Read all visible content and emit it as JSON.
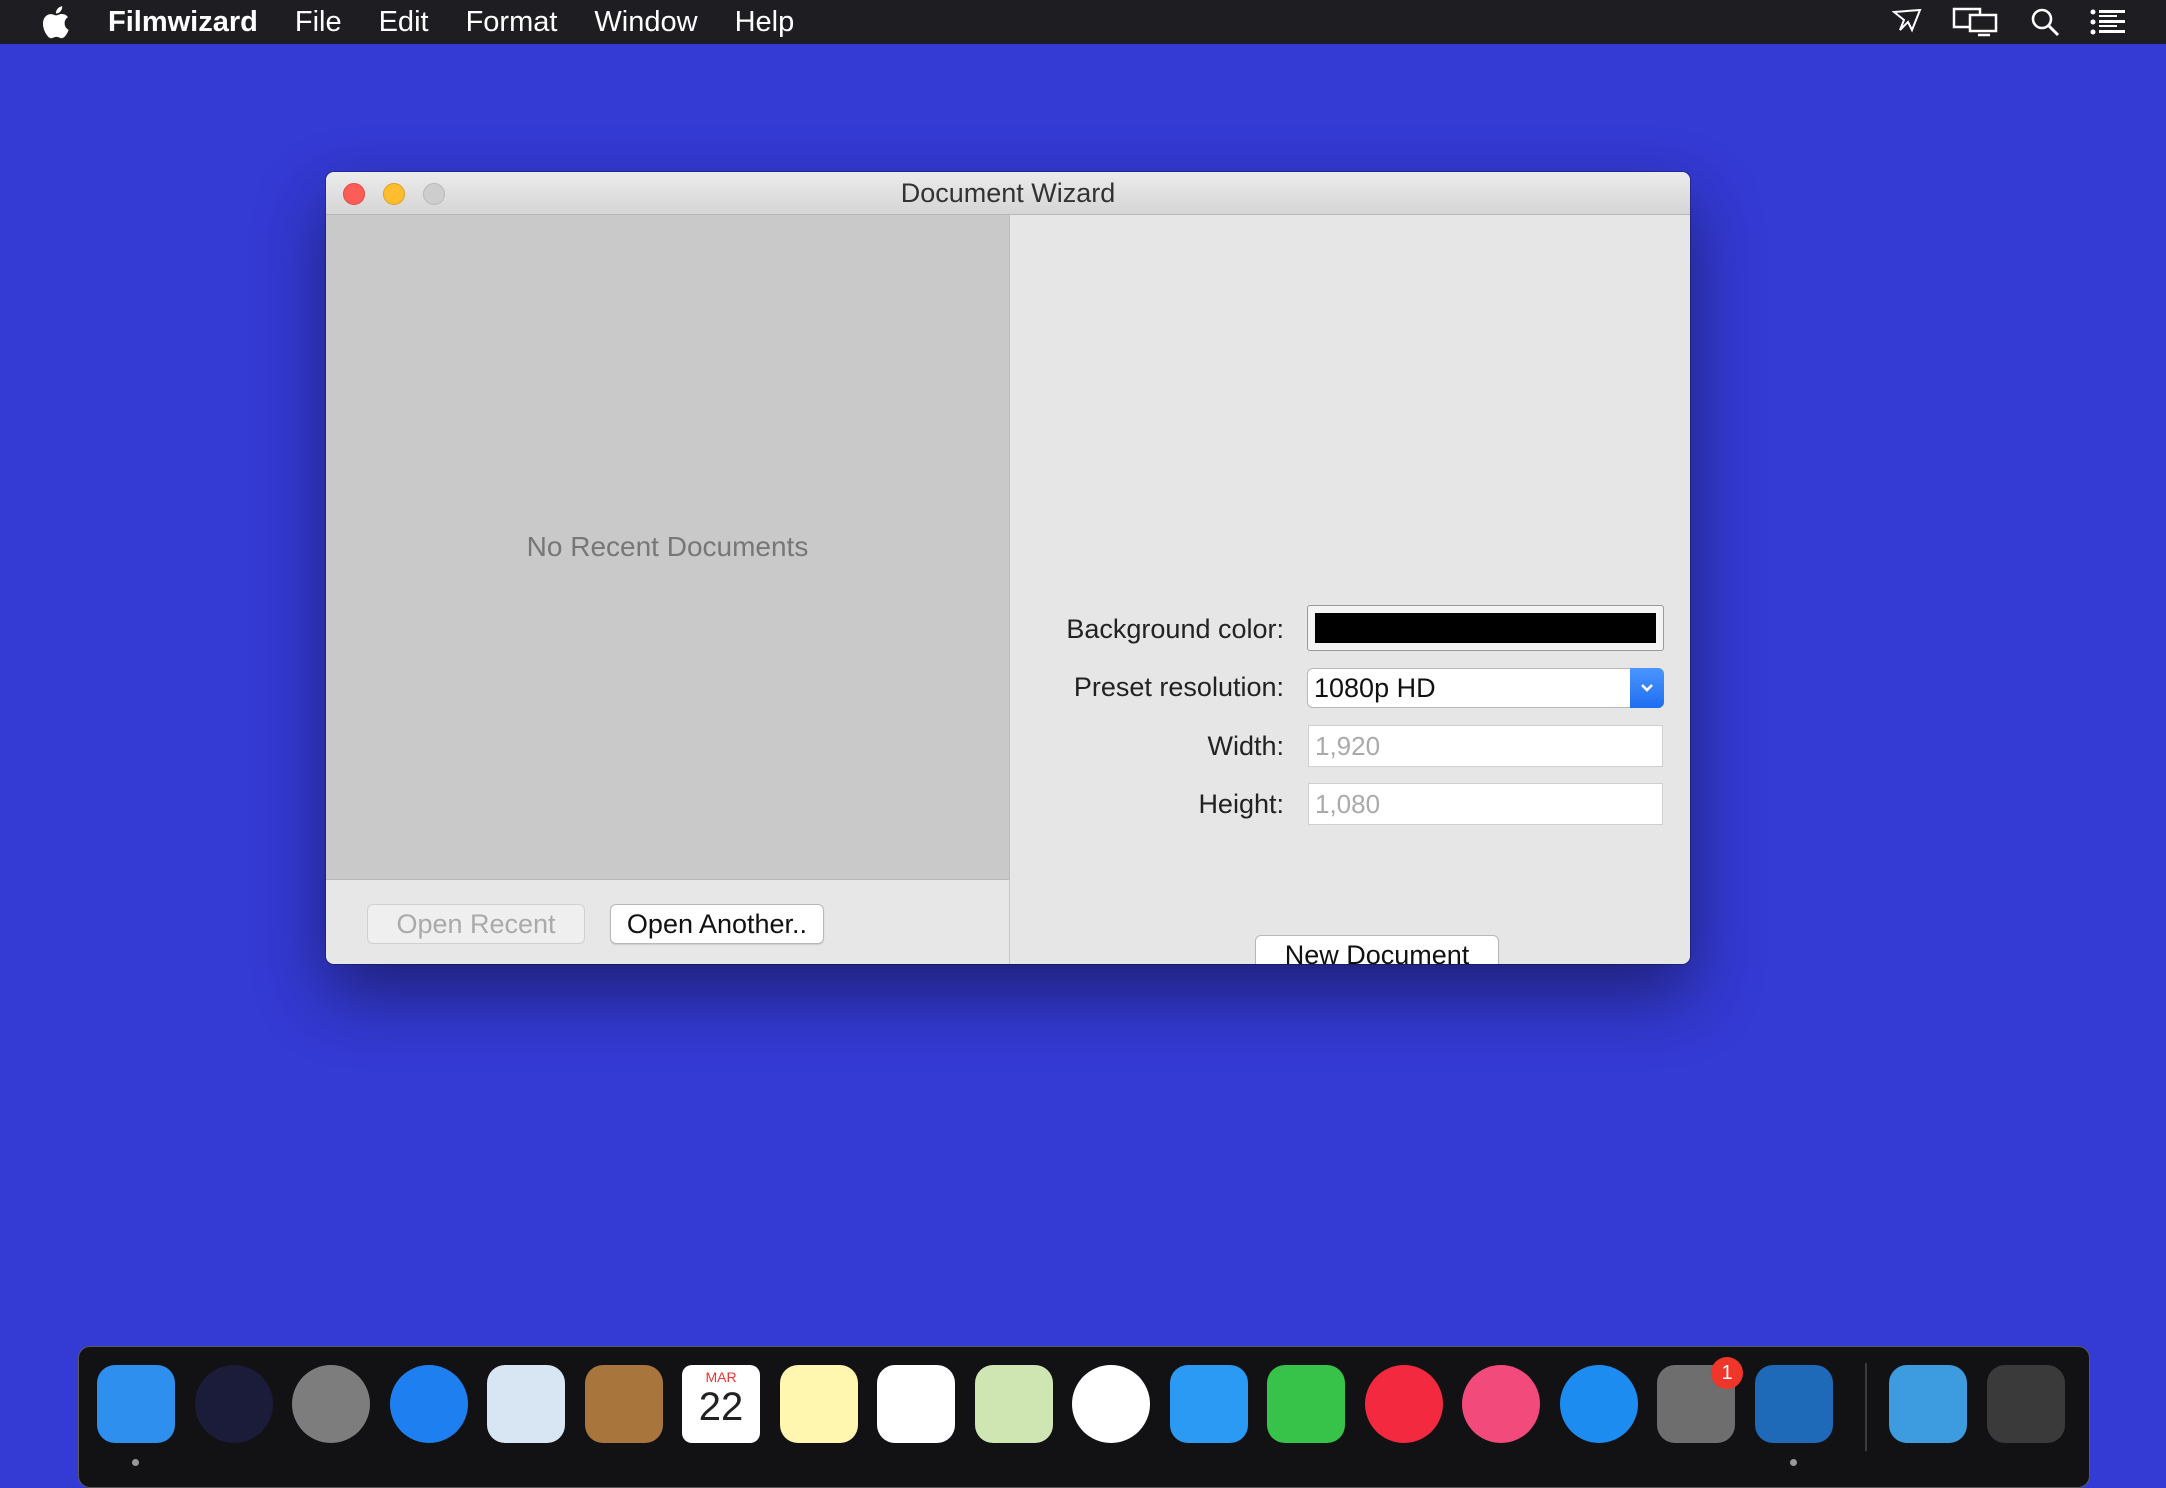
{
  "menubar": {
    "app_name": "Filmwizard",
    "items": [
      "File",
      "Edit",
      "Format",
      "Window",
      "Help"
    ],
    "status_icons": [
      "airplay-icon",
      "display-mirroring-icon",
      "spotlight-search-icon",
      "notification-center-icon"
    ]
  },
  "window": {
    "title": "Document Wizard",
    "left_pane": {
      "empty_message": "No Recent Documents",
      "open_recent_label": "Open Recent",
      "open_another_label": "Open Another.."
    },
    "form": {
      "background_color_label": "Background color:",
      "background_color_value": "#000000",
      "preset_label": "Preset resolution:",
      "preset_value": "1080p HD",
      "width_label": "Width:",
      "width_value": "1,920",
      "height_label": "Height:",
      "height_value": "1,080",
      "new_document_label": "New Document"
    }
  },
  "dock": {
    "items": [
      {
        "name": "finder-icon",
        "color": "#2f8fef",
        "running": true
      },
      {
        "name": "siri-icon",
        "color": "#1b1b3a"
      },
      {
        "name": "launchpad-icon",
        "color": "#7d7d7d"
      },
      {
        "name": "safari-icon",
        "color": "#1e7ff0"
      },
      {
        "name": "mail-icon",
        "color": "#d8e6f4"
      },
      {
        "name": "contacts-icon",
        "color": "#a8753d"
      },
      {
        "name": "calendar-icon",
        "color": "#ffffff",
        "month": "MAR",
        "day": "22"
      },
      {
        "name": "notes-icon",
        "color": "#fff6b0"
      },
      {
        "name": "reminders-icon",
        "color": "#ffffff"
      },
      {
        "name": "maps-icon",
        "color": "#cfe6b3"
      },
      {
        "name": "photos-icon",
        "color": "#ffffff"
      },
      {
        "name": "messages-icon",
        "color": "#2a9af5"
      },
      {
        "name": "facetime-icon",
        "color": "#37c24a"
      },
      {
        "name": "news-icon",
        "color": "#f2293f"
      },
      {
        "name": "itunes-icon",
        "color": "#f24a7a"
      },
      {
        "name": "app-store-icon",
        "color": "#1c8cf0"
      },
      {
        "name": "system-preferences-icon",
        "color": "#6e6e6e",
        "badge": "1"
      },
      {
        "name": "filmwizard-icon",
        "color": "#1f6ab8",
        "running": true
      },
      {
        "name": "downloads-folder-icon",
        "color": "#3d9be0"
      },
      {
        "name": "trash-icon",
        "color": "#3a3a3a"
      }
    ]
  }
}
